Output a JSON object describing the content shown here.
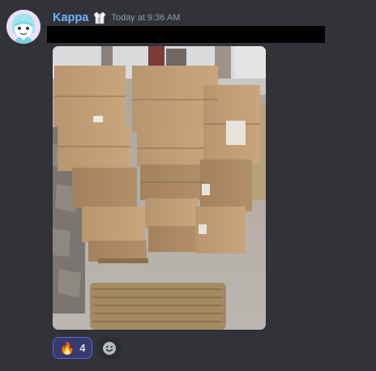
{
  "message": {
    "username": "Kappa",
    "timestamp": "Today at 9:36 AM",
    "avatar_icon": "cartoon-character-avatar",
    "role_icon": "lab-coat-icon",
    "attachment": {
      "kind": "photo",
      "subject": "stack of cardboard boxes on a porch with doormat"
    }
  },
  "reactions": [
    {
      "emoji": "🔥",
      "count": "4",
      "selected": true
    }
  ],
  "add_reaction_icon": "smiley-add-reaction-icon",
  "colors": {
    "background": "#313338",
    "username": "#6fb3ff",
    "timestamp": "#949ba4",
    "reaction_border": "#5865f2",
    "reaction_bg": "#373a6b"
  }
}
